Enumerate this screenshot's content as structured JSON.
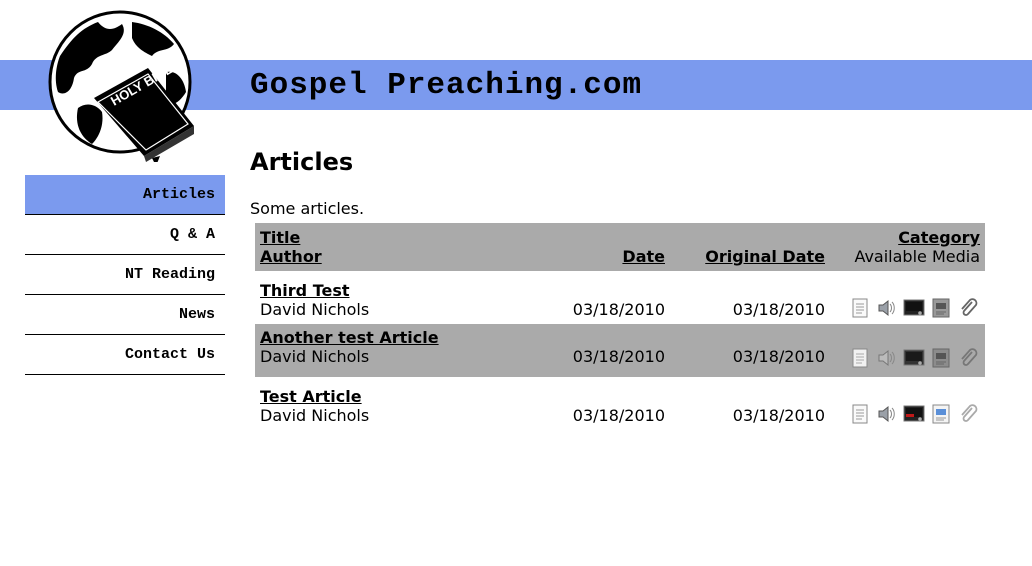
{
  "site": {
    "title": "Gospel Preaching.com",
    "logo_text": "HOLY BIBLE"
  },
  "nav": {
    "items": [
      {
        "label": "Articles",
        "active": true
      },
      {
        "label": "Q & A"
      },
      {
        "label": "NT Reading"
      },
      {
        "label": "News"
      },
      {
        "label": "Contact Us"
      }
    ]
  },
  "page": {
    "title": "Articles",
    "intro": "Some articles."
  },
  "table": {
    "header": {
      "title": "Title",
      "author": "Author",
      "date": "Date",
      "original_date": "Original Date",
      "category": "Category",
      "available_media": "Available Media"
    },
    "rows": [
      {
        "title": "Third Test",
        "author": "David Nichols",
        "date": "03/18/2010",
        "original_date": "03/18/2010"
      },
      {
        "title": "Another test Article",
        "author": "David Nichols",
        "date": "03/18/2010",
        "original_date": "03/18/2010"
      },
      {
        "title": "Test Article",
        "author": "David Nichols",
        "date": "03/18/2010",
        "original_date": "03/18/2010"
      }
    ]
  },
  "media_icons": [
    "document-icon",
    "audio-icon",
    "video-icon",
    "image-icon",
    "attachment-icon"
  ],
  "colors": {
    "accent": "#7b9aee",
    "row_shade": "#aaaaaa",
    "video_active": "#c01818"
  }
}
